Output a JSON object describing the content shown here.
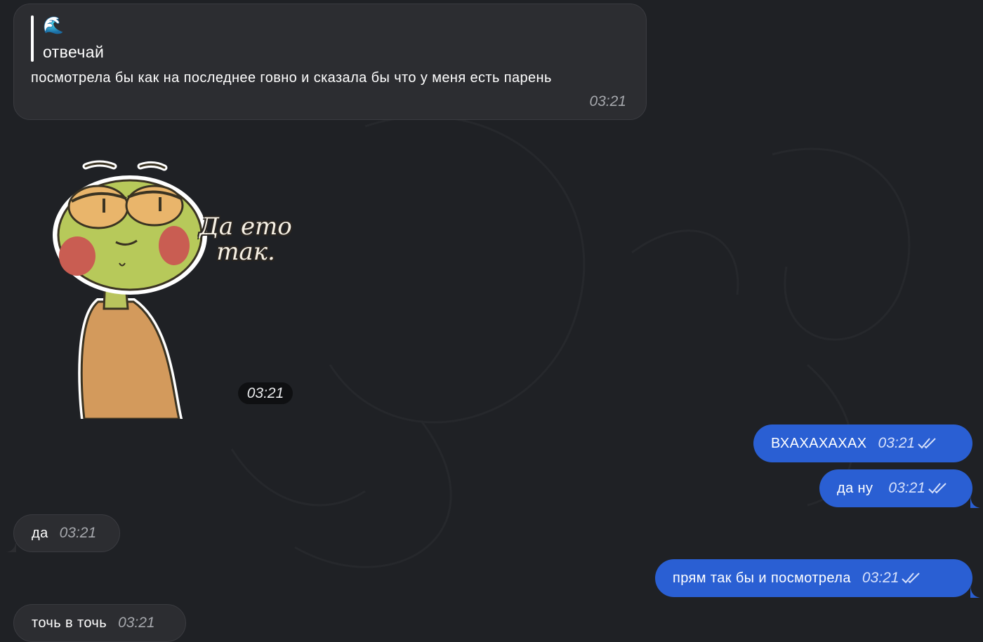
{
  "messages": [
    {
      "side": "in",
      "quote_emoji": "🌊",
      "quote_text": "отвечай",
      "text": "посмотрела бы как на последнее говно и сказала бы что у меня есть парень",
      "time": "03:21"
    },
    {
      "side": "in",
      "type": "sticker",
      "sticker_caption_line1": "Да ето",
      "sticker_caption_line2": "так.",
      "time": "03:21"
    },
    {
      "side": "out",
      "text": "ВХАХАХАХАХ",
      "time": "03:21",
      "status": "read"
    },
    {
      "side": "out",
      "text": "да ну",
      "time": "03:21",
      "status": "read"
    },
    {
      "side": "in",
      "text": "да",
      "time": "03:21"
    },
    {
      "side": "out",
      "text": "прям так бы и посмотрела",
      "time": "03:21",
      "status": "read"
    },
    {
      "side": "in",
      "text": "точь в точь",
      "time": "03:21"
    }
  ],
  "colors": {
    "background": "#1f2125",
    "incoming": "#2c2d31",
    "outgoing": "#2a5fd3"
  },
  "icons": {
    "read_status": "double-check-icon"
  }
}
